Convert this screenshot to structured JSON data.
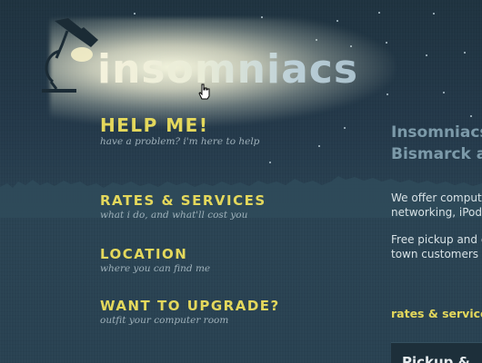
{
  "site": {
    "logo_text": "insomniacs"
  },
  "nav": {
    "items": [
      {
        "title": "HELP ME!",
        "subtitle": "have a problem? i'm here to help"
      },
      {
        "title": "RATES & SERVICES",
        "subtitle": "what i do, and what'll cost you"
      },
      {
        "title": "LOCATION",
        "subtitle": "where you can find me"
      },
      {
        "title": "WANT TO UPGRADE?",
        "subtitle": "outfit your computer room"
      }
    ]
  },
  "main": {
    "heading_line1": "Insomniacs",
    "heading_line2": "Bismarck a",
    "para1_line1": "We offer compute",
    "para1_line2": "networking, iPod",
    "para2_line1": "Free pickup and c",
    "para2_line2": "town customers a",
    "rates_link": "rates & service",
    "panel_title": "Pickup & "
  },
  "colors": {
    "accent_yellow": "#e4d85c",
    "background": "#27404f",
    "heading_blue": "#7c9aa9"
  },
  "icons": {
    "lamp": "desk-lamp-icon",
    "cursor": "hand-pointer-icon"
  }
}
